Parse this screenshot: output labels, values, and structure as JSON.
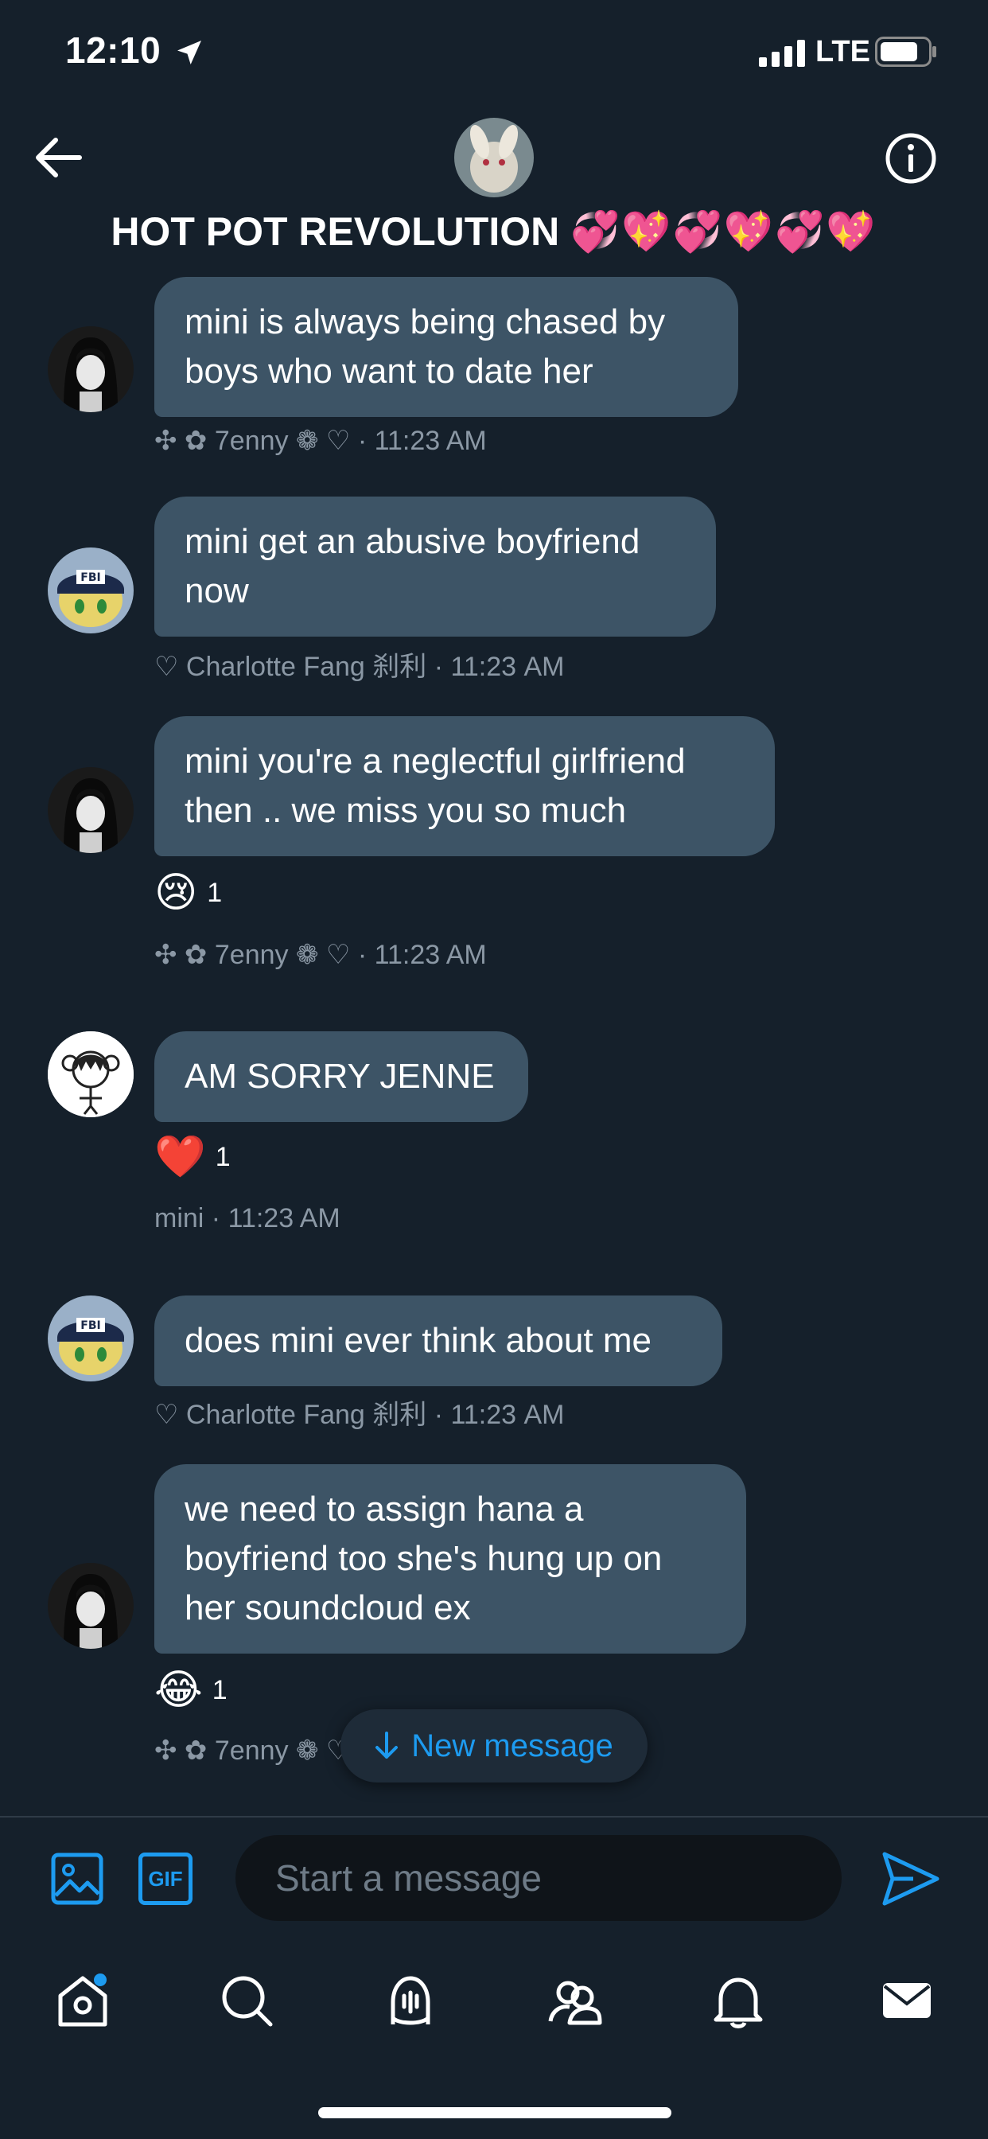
{
  "status_bar": {
    "time": "12:10",
    "network": "LTE"
  },
  "header": {
    "title": "HOT POT REVOLUTION",
    "title_emoji": "💞💖💞💖💞💖"
  },
  "messages": [
    {
      "text": "mini is always being chased by boys who want to date her",
      "sender": "✣ ✿ 7enny ❁ ♡",
      "time": "11:23 AM"
    },
    {
      "text": "mini get an abusive boyfriend now",
      "sender": "♡ Charlotte Fang 刹利",
      "time": "11:23 AM"
    },
    {
      "text": "mini you're a neglectful girlfriend then .. we miss you so much",
      "reaction_emoji": "😢",
      "reaction_count": "1",
      "sender": "✣ ✿ 7enny ❁ ♡",
      "time": "11:23 AM"
    },
    {
      "text": "AM SORRY JENNE",
      "reaction_emoji": "❤️",
      "reaction_count": "1",
      "sender": "mini",
      "time": "11:23 AM"
    },
    {
      "text": "does mini ever think about me",
      "sender": "♡ Charlotte Fang 刹利",
      "time": "11:23 AM"
    },
    {
      "text": "we need to assign hana a boyfriend too she's hung up on her soundcloud ex",
      "reaction_emoji": "😂",
      "reaction_count": "1",
      "sender": "✣ ✿ 7enny ❁ ♡"
    }
  ],
  "new_message_label": "New message",
  "composer": {
    "placeholder": "Start a message",
    "gif_label": "GIF"
  },
  "colors": {
    "background": "#15202b",
    "bubble": "#3d5466",
    "accent": "#1d9bf0",
    "meta": "#8b98a5"
  },
  "icons": [
    "location-arrow-icon",
    "back-arrow-icon",
    "info-icon",
    "image-icon",
    "gif-icon",
    "send-icon",
    "home-icon",
    "search-icon",
    "spaces-icon",
    "communities-icon",
    "notifications-icon",
    "messages-icon"
  ]
}
